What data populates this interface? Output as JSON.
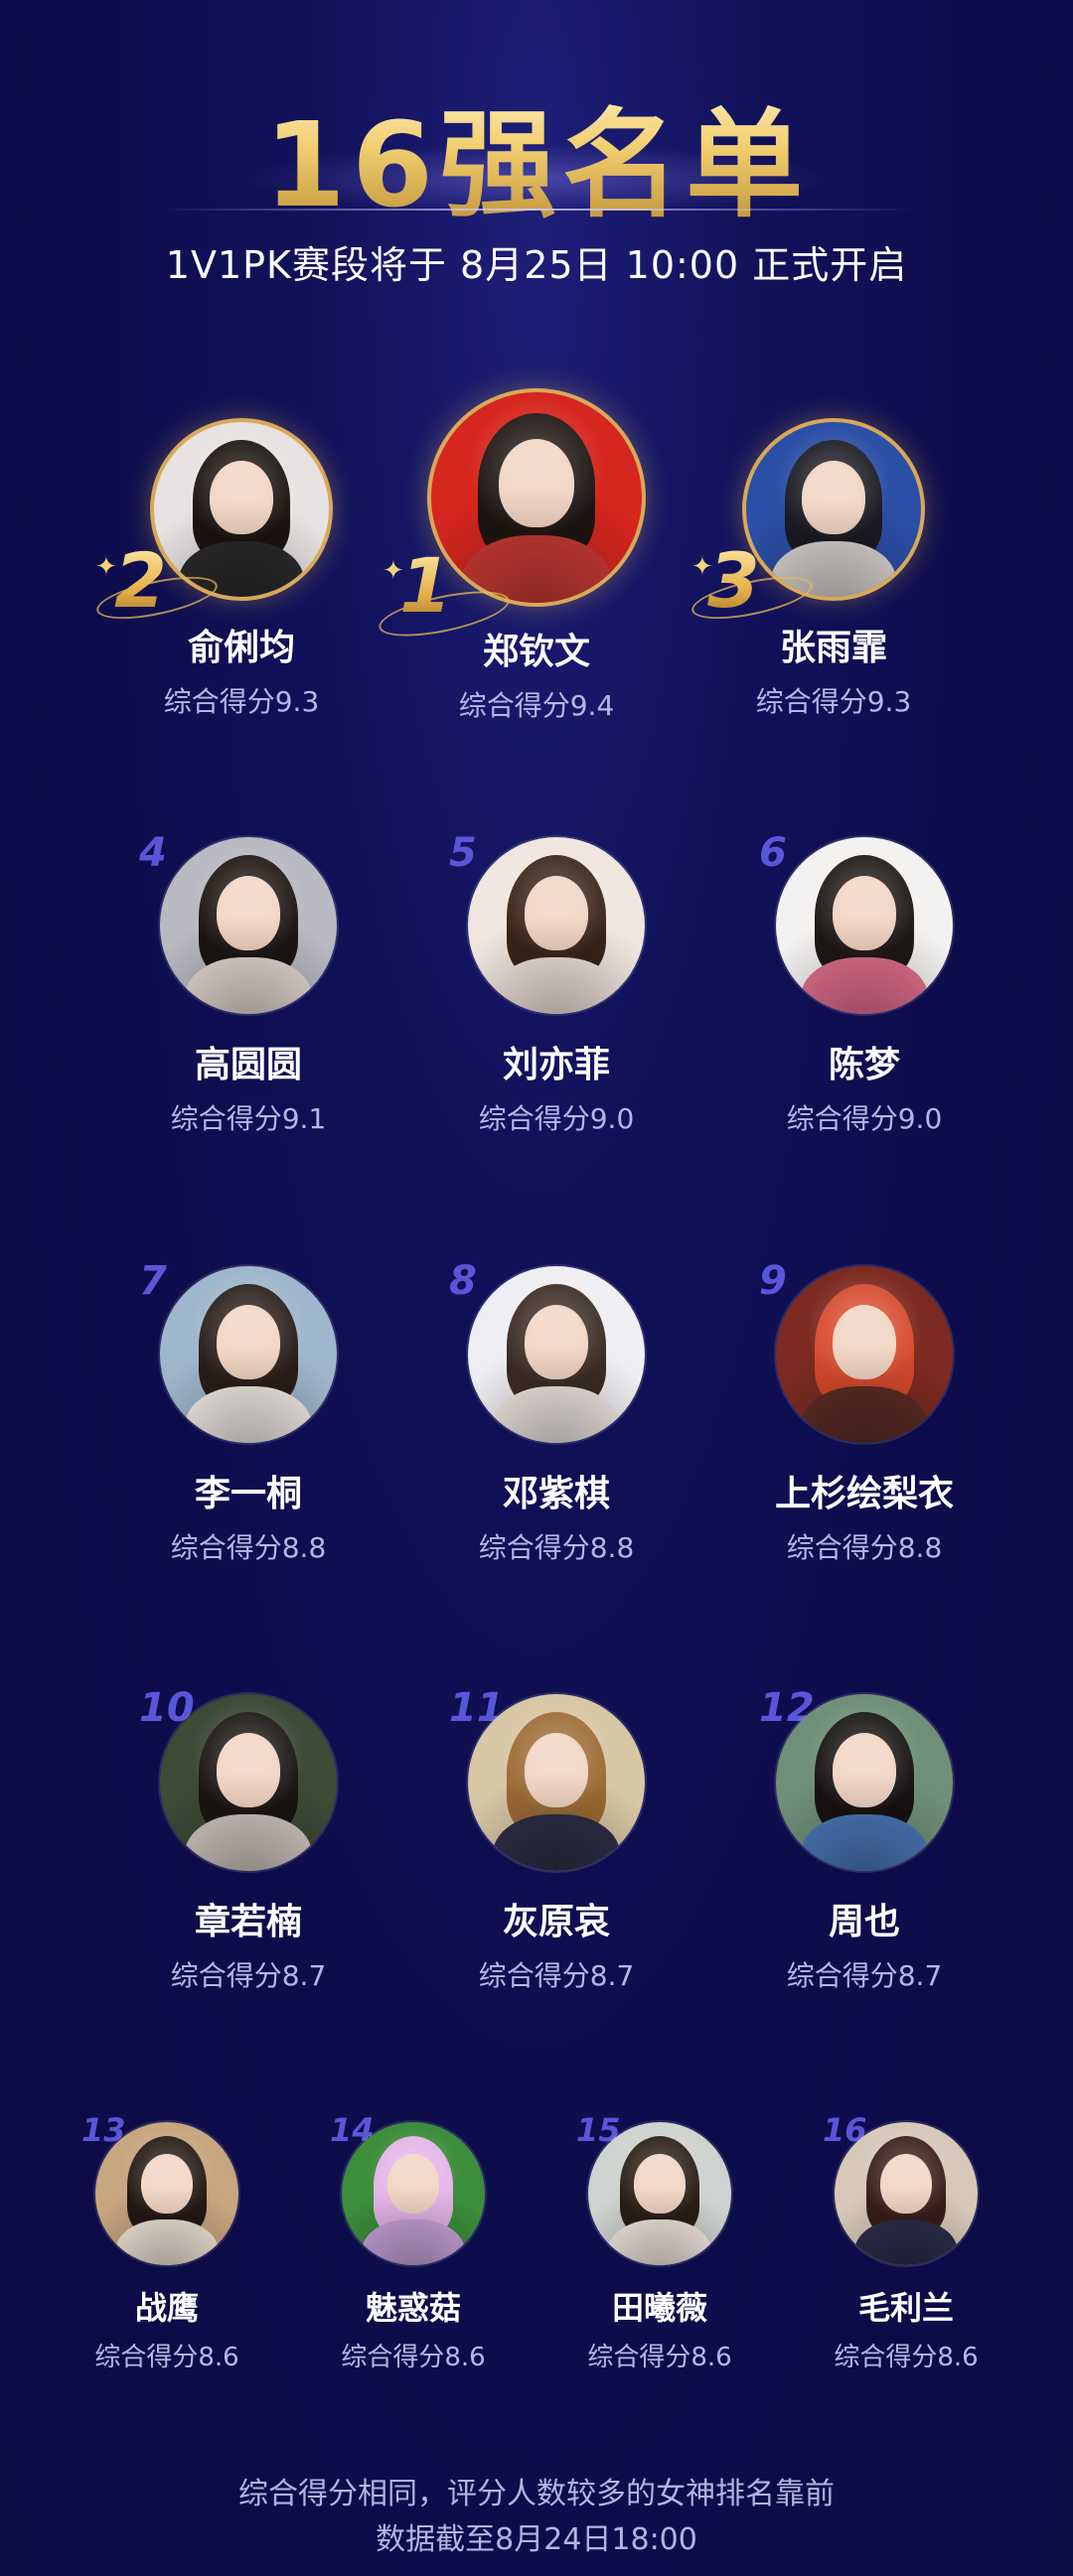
{
  "title": "16强名单",
  "subtitle": "1V1PK赛段将于 8月25日 10:00 正式开启",
  "podium": [
    {
      "rank": "2",
      "name": "俞俐均",
      "score": "综合得分9.3",
      "bg": "#e8e3e2",
      "hair": "#1b1411",
      "body": "#2b2b2b"
    },
    {
      "rank": "1",
      "name": "郑钦文",
      "score": "综合得分9.4",
      "bg": "#d5261f",
      "hair": "#1d1512",
      "body": "#c93a33"
    },
    {
      "rank": "3",
      "name": "张雨霏",
      "score": "综合得分9.3",
      "bg": "#2b4fa6",
      "hair": "#1b1a22",
      "body": "#d9d3ce"
    }
  ],
  "row2": [
    {
      "rank": "4",
      "name": "高圆圆",
      "score": "综合得分9.1",
      "bg": "#b9b9c2",
      "hair": "#1c1612",
      "body": "#e5d9d2"
    },
    {
      "rank": "5",
      "name": "刘亦菲",
      "score": "综合得分9.0",
      "bg": "#efe6df",
      "hair": "#3b2418",
      "body": "#f0e4dc"
    },
    {
      "rank": "6",
      "name": "陈梦",
      "score": "综合得分9.0",
      "bg": "#f4f2f0",
      "hair": "#1e1815",
      "body": "#e36f8e"
    }
  ],
  "row3": [
    {
      "rank": "7",
      "name": "李一桐",
      "score": "综合得分8.8",
      "bg": "#9fb7cc",
      "hair": "#2a1d19",
      "body": "#f2ece8"
    },
    {
      "rank": "8",
      "name": "邓紫棋",
      "score": "综合得分8.8",
      "bg": "#efeef2",
      "hair": "#3b2b24",
      "body": "#efe7e2"
    },
    {
      "rank": "9",
      "name": "上杉绘梨衣",
      "score": "综合得分8.8",
      "bg": "#7d2b22",
      "hair": "#d7492c",
      "body": "#5c2c25"
    }
  ],
  "row4": [
    {
      "rank": "10",
      "name": "章若楠",
      "score": "综合得分8.7",
      "bg": "#3c4a36",
      "hair": "#1a1512",
      "body": "#cfc6c0"
    },
    {
      "rank": "11",
      "name": "灰原哀",
      "score": "综合得分8.7",
      "bg": "#d8c7a5",
      "hair": "#9c6a34",
      "body": "#2e2e48"
    },
    {
      "rank": "12",
      "name": "周也",
      "score": "综合得分8.7",
      "bg": "#6f8f78",
      "hair": "#161212",
      "body": "#4a78b8"
    }
  ],
  "row5": [
    {
      "rank": "13",
      "name": "战鹰",
      "score": "综合得分8.6",
      "bg": "#c7a57f",
      "hair": "#231914",
      "body": "#efe5d6"
    },
    {
      "rank": "14",
      "name": "魅惑菇",
      "score": "综合得分8.6",
      "bg": "#3c8d3c",
      "hair": "#e3b4e6",
      "body": "#c7a2d8"
    },
    {
      "rank": "15",
      "name": "田曦薇",
      "score": "综合得分8.6",
      "bg": "#cfd3d0",
      "hair": "#2a1d17",
      "body": "#f2e8e1"
    },
    {
      "rank": "16",
      "name": "毛利兰",
      "score": "综合得分8.6",
      "bg": "#d7c9b9",
      "hair": "#3a1e18",
      "body": "#2c2d4c"
    }
  ],
  "footer": {
    "line1": "综合得分相同，评分人数较多的女神排名靠前",
    "line2": "数据截至8月24日18:00"
  }
}
